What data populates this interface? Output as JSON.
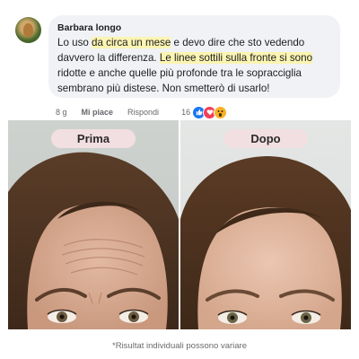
{
  "comment": {
    "author": "Barbara longo",
    "text_parts": [
      "Lo uso ",
      "da circa un mese",
      " e devo dire che sto vedendo davvero la differenza. ",
      "Le linee sottili sulla fronte si sono",
      " ridotte e anche quelle più profonde tra le sopracciglia sembrano più distese. Non smetterò di usarlo!"
    ],
    "actions": {
      "time": "8 g",
      "like": "Mi piace",
      "reply": "Rispondi",
      "reaction_count": "16"
    },
    "reaction_icons": [
      "like-icon",
      "love-icon",
      "wow-icon"
    ]
  },
  "photos": {
    "before_label": "Prima",
    "after_label": "Dopo"
  },
  "caption": "*Risultat  individuali possono variare",
  "colors": {
    "bubble": "#f0f2f5",
    "highlight": "#fbf4b2",
    "label_pill": "#f2dfe2",
    "like_blue": "#1877f2",
    "love_red": "#f33e58",
    "wow_yellow": "#f7b125"
  }
}
